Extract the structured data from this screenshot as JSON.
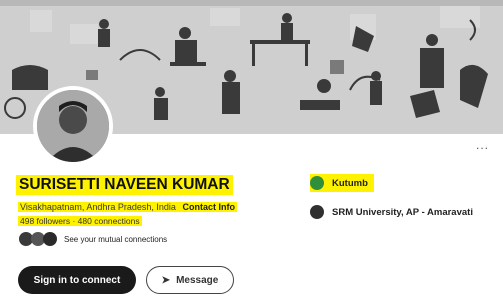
{
  "profile": {
    "name": "SURISETTI NAVEEN KUMAR",
    "location": "Visakhapatnam, Andhra Pradesh, India",
    "contact_info": "Contact Info",
    "followers": "498 followers",
    "connections": "480 connections",
    "mutual": "See your mutual connections"
  },
  "actions": {
    "connect": "Sign in to connect",
    "message": "Message"
  },
  "experience": [
    {
      "org": "Kutumb",
      "icon": "green-logo-icon",
      "color": "#2f8f3a"
    },
    {
      "org": "SRM University, AP - Amaravati",
      "icon": "university-crest-icon",
      "color": "#303030"
    }
  ],
  "menu": {
    "more": "..."
  },
  "colors": {
    "highlight": "#fff200",
    "primary_button": "#1a1a1a"
  }
}
